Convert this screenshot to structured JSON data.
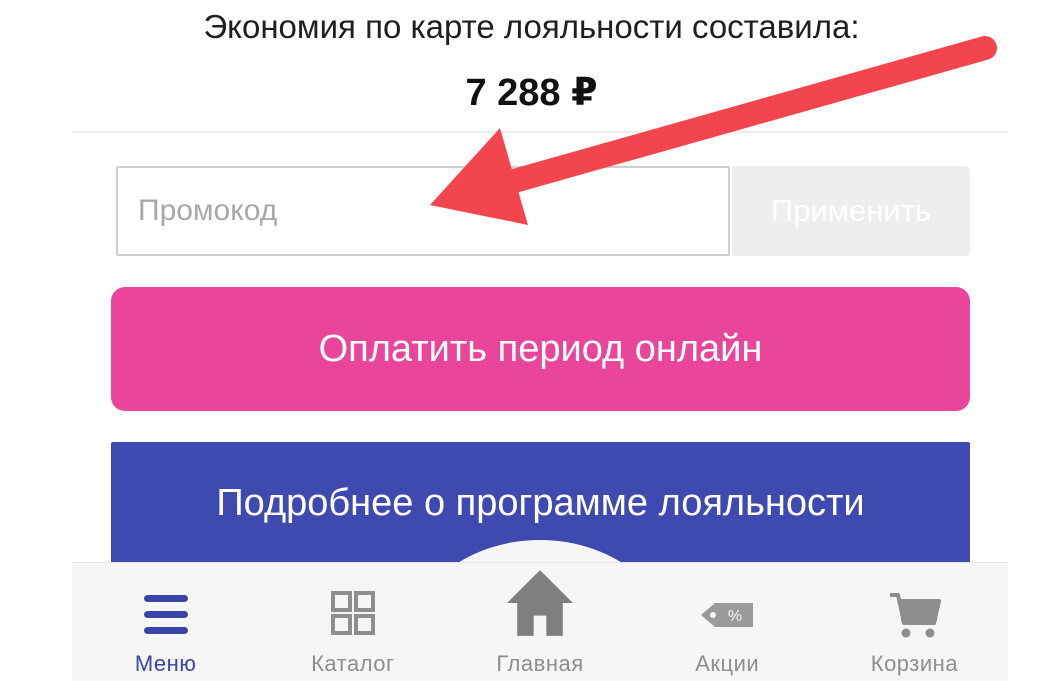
{
  "summary": {
    "savings_label": "Экономия по карте лояльности составила:",
    "savings_amount": "7 288 ₽"
  },
  "promo": {
    "placeholder": "Промокод",
    "value": "",
    "apply_label": "Применить"
  },
  "actions": {
    "pay_label": "Оплатить период онлайн",
    "loyalty_label": "Подробнее о программе лояльности"
  },
  "tabbar": {
    "items": [
      {
        "label": "Меню",
        "icon": "menu-icon",
        "active": true
      },
      {
        "label": "Каталог",
        "icon": "grid-icon",
        "active": false
      },
      {
        "label": "Главная",
        "icon": "home-icon",
        "active": false
      },
      {
        "label": "Акции",
        "icon": "discount-tag-icon",
        "active": false
      },
      {
        "label": "Корзина",
        "icon": "cart-icon",
        "active": false
      }
    ]
  },
  "colors": {
    "pay_button": "#e8459b",
    "loyalty_button": "#3e4ab0",
    "active_tab": "#3a44a8",
    "inactive_tab": "#8e8e8e",
    "annotation_arrow": "#f2454e"
  }
}
